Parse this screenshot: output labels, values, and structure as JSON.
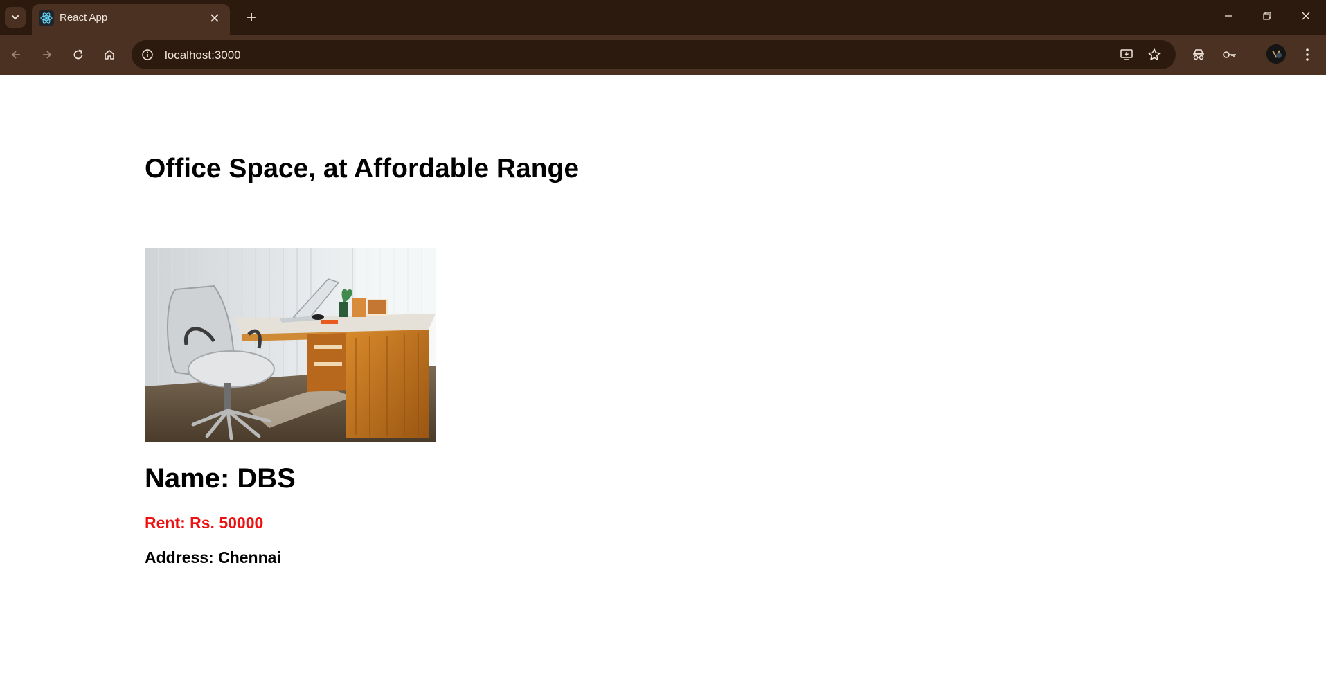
{
  "browser": {
    "tab_title": "React App",
    "url": "localhost:3000",
    "icons": {
      "tab_menu": "chevron-down-icon",
      "favicon": "react-logo-icon",
      "tab_close": "close-icon",
      "new_tab": "plus-icon",
      "minimize": "minimize-icon",
      "restore": "restore-icon",
      "close_window": "close-icon",
      "back": "arrow-left-icon",
      "forward": "arrow-right-icon",
      "reload": "reload-icon",
      "home": "home-icon",
      "site_info": "info-icon",
      "install": "install-app-icon",
      "bookmark": "star-icon",
      "incognito": "incognito-icon",
      "passwords": "key-icon",
      "profile": "avatar",
      "menu": "kebab-menu-icon"
    },
    "colors": {
      "tab_strip": "#2c1a0e",
      "toolbar": "#4b3121",
      "omnibox": "#2c1a0e"
    }
  },
  "page": {
    "heading": "Office Space, at Affordable Range",
    "office": {
      "name": "Name: DBS",
      "rent": "Rent: Rs. 50000",
      "address": "Address: Chennai",
      "rent_color": "#ee1111"
    }
  }
}
